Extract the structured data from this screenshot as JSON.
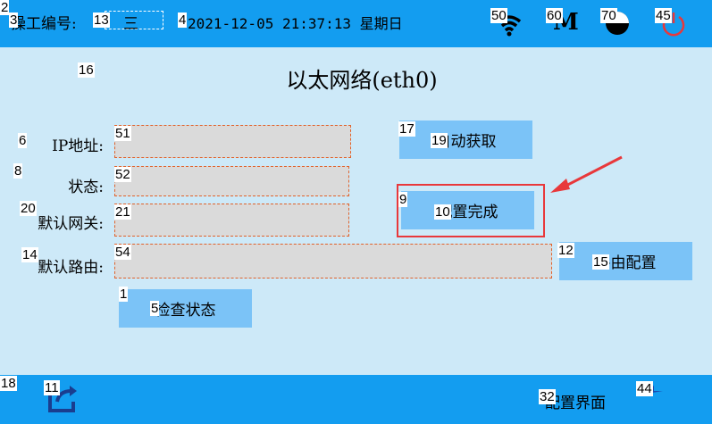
{
  "topbar": {
    "operator_label": "操工编号:",
    "operator_value": "三",
    "datetime": "2021-12-05 21:37:13 星期日",
    "m_label": "M"
  },
  "page": {
    "title": "以太网络(eth0)"
  },
  "form": {
    "ip_label": "IP地址:",
    "ip_value": "",
    "status_label": "状态:",
    "status_value": "",
    "gateway_label": "默认网关:",
    "gateway_value": "",
    "route_label": "默认路由:",
    "route_value": ""
  },
  "buttons": {
    "auto_get": "自动获取",
    "config_done": "配置完成",
    "route_config": "路由配置",
    "check_status": "检查状态"
  },
  "footer": {
    "config_page": "配置界面"
  },
  "tags": {
    "t1": "1",
    "t2": "2",
    "t3": "3",
    "t4": "4",
    "t5": "5",
    "t6": "6",
    "t8": "8",
    "t9": "9",
    "t10": "10",
    "t11": "11",
    "t12": "12",
    "t13": "13",
    "t14": "14",
    "t15": "15",
    "t16": "16",
    "t17": "17",
    "t18": "18",
    "t19": "19",
    "t20": "20",
    "t21": "21",
    "t32": "32",
    "t44": "44",
    "t45": "45",
    "t50": "50",
    "t51": "51",
    "t52": "52",
    "t54": "54",
    "t60": "60",
    "t70": "70"
  },
  "colors": {
    "bar": "#139df0",
    "background": "#cde9f8",
    "button": "#7bc3f7",
    "field": "#dadada",
    "field_border": "#e0622b",
    "highlight": "#e8383b",
    "power_icon": "#e8383b"
  }
}
